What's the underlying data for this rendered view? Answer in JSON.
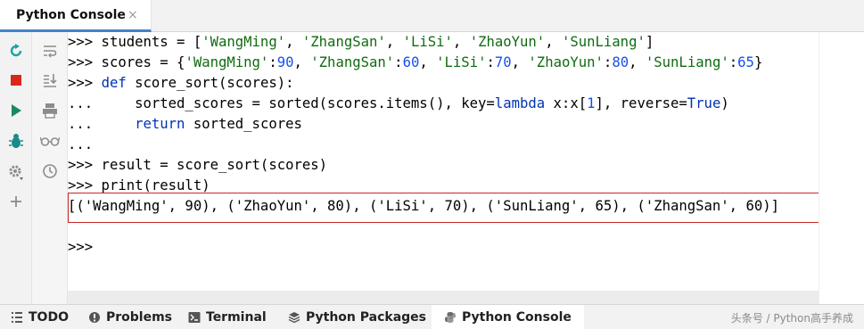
{
  "tab": {
    "title": "Python Console",
    "close_glyph": "×"
  },
  "left_toolbar": {
    "icons": [
      "rerun-icon",
      "stop-icon",
      "run-icon",
      "debug-icon",
      "settings-icon",
      "add-icon"
    ],
    "colors": {
      "rerun": "#1aa3a3",
      "stop": "#d9281b",
      "run": "#1a8a5a",
      "debug": "#1aa3a3",
      "gray": "#8c8c8c"
    }
  },
  "side_toolbar": {
    "icons": [
      "soft-wrap-icon",
      "scroll-to-end-icon",
      "print-icon",
      "show-variables-icon",
      "history-icon"
    ]
  },
  "console": {
    "lines": [
      [
        {
          "c": "p",
          "t": ">>> students = ["
        },
        {
          "c": "s",
          "t": "'WangMing'"
        },
        {
          "c": "p",
          "t": ", "
        },
        {
          "c": "s",
          "t": "'ZhangSan'"
        },
        {
          "c": "p",
          "t": ", "
        },
        {
          "c": "s",
          "t": "'LiSi'"
        },
        {
          "c": "p",
          "t": ", "
        },
        {
          "c": "s",
          "t": "'ZhaoYun'"
        },
        {
          "c": "p",
          "t": ", "
        },
        {
          "c": "s",
          "t": "'SunLiang'"
        },
        {
          "c": "p",
          "t": "]"
        }
      ],
      [
        {
          "c": "p",
          "t": ">>> scores = {"
        },
        {
          "c": "s",
          "t": "'WangMing'"
        },
        {
          "c": "p",
          "t": ":"
        },
        {
          "c": "n",
          "t": "90"
        },
        {
          "c": "p",
          "t": ", "
        },
        {
          "c": "s",
          "t": "'ZhangSan'"
        },
        {
          "c": "p",
          "t": ":"
        },
        {
          "c": "n",
          "t": "60"
        },
        {
          "c": "p",
          "t": ", "
        },
        {
          "c": "s",
          "t": "'LiSi'"
        },
        {
          "c": "p",
          "t": ":"
        },
        {
          "c": "n",
          "t": "70"
        },
        {
          "c": "p",
          "t": ", "
        },
        {
          "c": "s",
          "t": "'ZhaoYun'"
        },
        {
          "c": "p",
          "t": ":"
        },
        {
          "c": "n",
          "t": "80"
        },
        {
          "c": "p",
          "t": ", "
        },
        {
          "c": "s",
          "t": "'SunLiang'"
        },
        {
          "c": "p",
          "t": ":"
        },
        {
          "c": "n",
          "t": "65"
        },
        {
          "c": "p",
          "t": "}"
        }
      ],
      [
        {
          "c": "p",
          "t": ">>> "
        },
        {
          "c": "k",
          "t": "def"
        },
        {
          "c": "p",
          "t": " score_sort(scores):"
        }
      ],
      [
        {
          "c": "p",
          "t": "...     sorted_scores = sorted(scores.items(), "
        },
        {
          "c": "p",
          "t": "key="
        },
        {
          "c": "k",
          "t": "lambda"
        },
        {
          "c": "p",
          "t": " x:x["
        },
        {
          "c": "n",
          "t": "1"
        },
        {
          "c": "p",
          "t": "], reverse="
        },
        {
          "c": "k",
          "t": "True"
        },
        {
          "c": "p",
          "t": ")"
        }
      ],
      [
        {
          "c": "p",
          "t": "...     "
        },
        {
          "c": "k",
          "t": "return"
        },
        {
          "c": "p",
          "t": " sorted_scores"
        }
      ],
      [
        {
          "c": "p",
          "t": "..."
        }
      ],
      [
        {
          "c": "p",
          "t": ">>> result = score_sort(scores)"
        }
      ],
      [
        {
          "c": "p",
          "t": ">>> print(result)"
        }
      ],
      [
        {
          "c": "p",
          "t": "[('WangMing', 90), ('ZhaoYun', 80), ('LiSi', 70), ('SunLiang', 65), ('ZhangSan', 60)]"
        }
      ],
      [
        {
          "c": "p",
          "t": ""
        }
      ],
      [
        {
          "c": "p",
          "t": ">>>"
        }
      ]
    ]
  },
  "bottom_bar": {
    "tabs": [
      {
        "label": "TODO",
        "icon": "todo-list-icon"
      },
      {
        "label": "Problems",
        "icon": "problems-icon"
      },
      {
        "label": "Terminal",
        "icon": "terminal-icon"
      },
      {
        "label": "Python Packages",
        "icon": "packages-icon"
      },
      {
        "label": "Python Console",
        "icon": "python-icon",
        "active": true
      }
    ],
    "watermark": "头条号 / Python高手养成"
  }
}
